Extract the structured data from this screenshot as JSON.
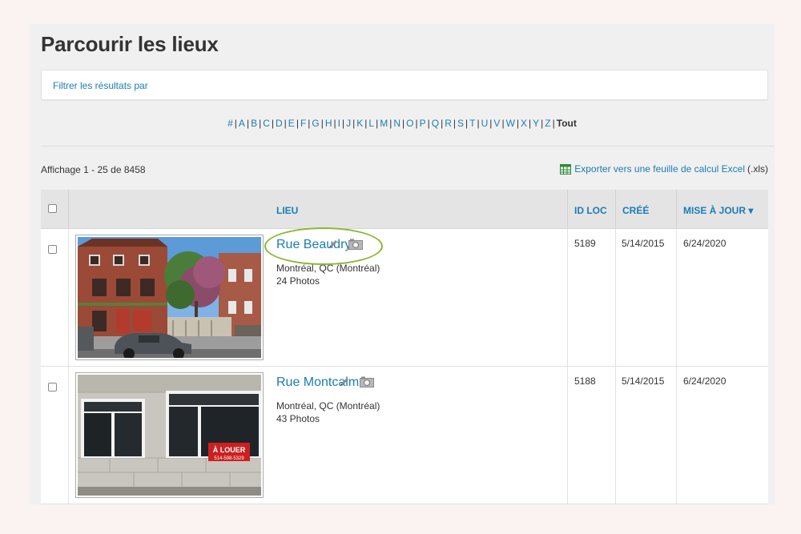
{
  "page": {
    "title": "Parcourir les lieux"
  },
  "filter": {
    "label": "Filtrer les résultats par"
  },
  "alpha": {
    "letters": [
      "#",
      "A",
      "B",
      "C",
      "D",
      "E",
      "F",
      "G",
      "H",
      "I",
      "J",
      "K",
      "L",
      "M",
      "N",
      "O",
      "P",
      "Q",
      "R",
      "S",
      "T",
      "U",
      "V",
      "W",
      "X",
      "Y",
      "Z"
    ],
    "active": "Tout"
  },
  "results": {
    "count_text": "Affichage 1 - 25 de 8458"
  },
  "export": {
    "link": "Exporter vers une feuille de calcul Excel",
    "ext": "(.xls)"
  },
  "table": {
    "headers": {
      "lieu": "LIEU",
      "id": "ID LOC",
      "cree": "CRÉÉ",
      "maj": "MISE À JOUR ▾"
    },
    "rows": [
      {
        "name": "Rue Beaudry",
        "location": "Montréal, QC (Montréal)",
        "photos": "24 Photos",
        "id": "5189",
        "created": "5/14/2015",
        "updated": "6/24/2020"
      },
      {
        "name": "Rue Montcalm",
        "location": "Montréal, QC (Montréal)",
        "photos": "43 Photos",
        "id": "5188",
        "created": "5/14/2015",
        "updated": "6/24/2020"
      }
    ]
  },
  "sign": {
    "line1": "À LOUER",
    "line2": "514-598-5329"
  },
  "colors": {
    "link": "#1a7db5",
    "highlight": "#8ab733",
    "excel_green": "#2e8b3a"
  }
}
